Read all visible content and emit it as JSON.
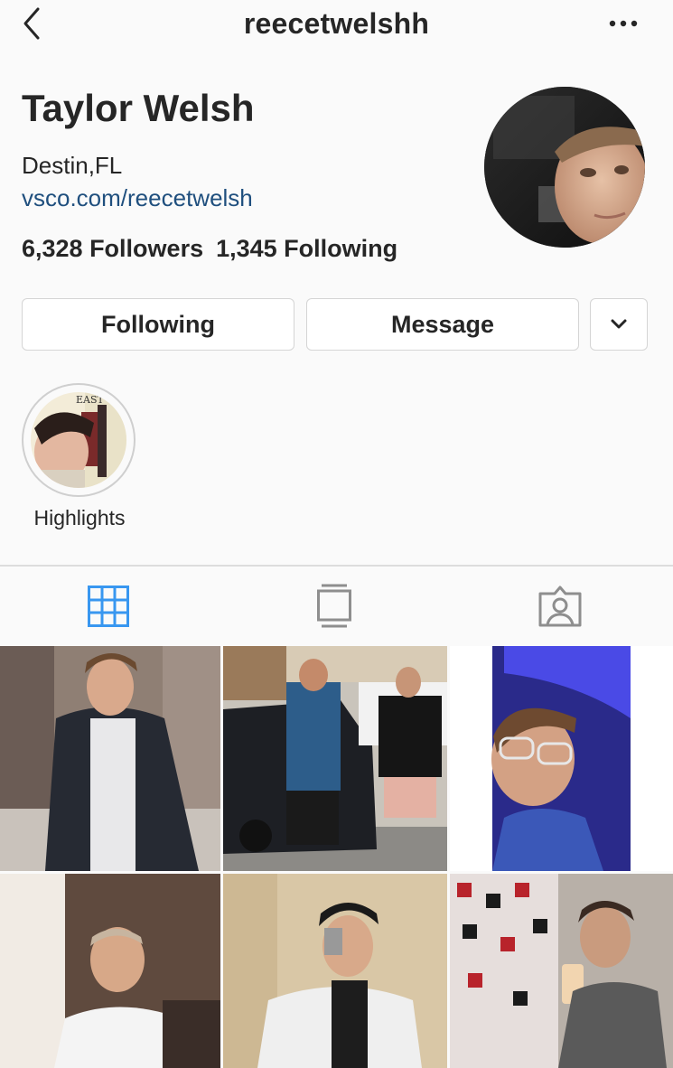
{
  "header": {
    "username": "reecetwelshh",
    "back_icon": "chevron-left-icon",
    "more_icon": "more-horizontal-icon"
  },
  "profile": {
    "name": "Taylor Welsh",
    "location": "Destin,FL",
    "website": "vsco.com/reecetwelsh",
    "followers": "6,328 Followers",
    "following": "1,345 Following"
  },
  "actions": {
    "following_label": "Following",
    "message_label": "Message",
    "dropdown_icon": "chevron-down-icon"
  },
  "highlight": {
    "label": "Highlights"
  },
  "tabs": [
    {
      "icon": "grid-icon",
      "active": true
    },
    {
      "icon": "feed-icon",
      "active": false
    },
    {
      "icon": "tagged-icon",
      "active": false
    }
  ],
  "colors": {
    "accent": "#3897f0",
    "link": "#1f4f7e",
    "text": "#262626",
    "background": "#fafafa",
    "border": "#dcdcdc"
  }
}
